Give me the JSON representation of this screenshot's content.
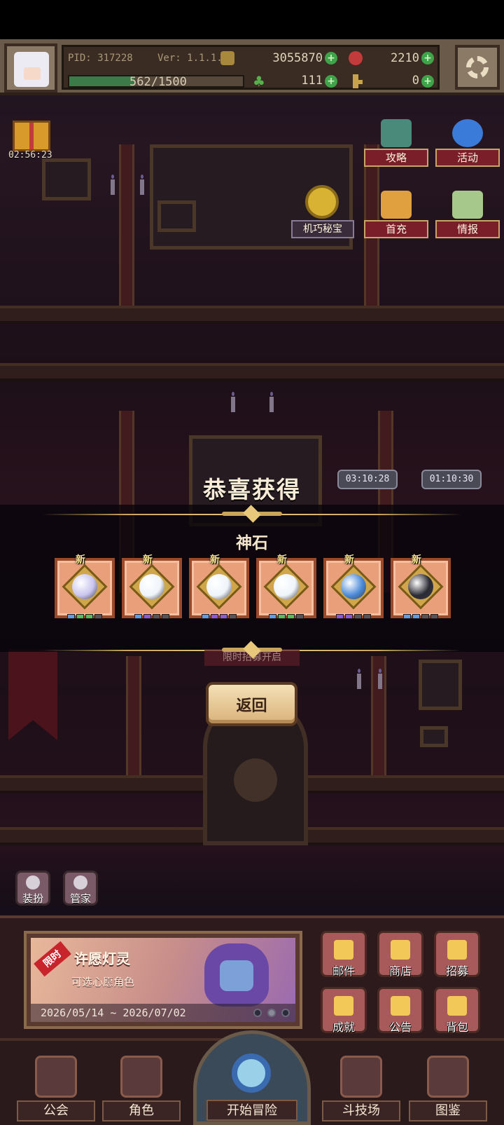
{
  "hud": {
    "pid_label": "PID: 317228",
    "version_label": "Ver: 1.1.1.4",
    "gold": "3055870",
    "gems": "2210",
    "exp_text": "562/1500",
    "exp_progress": 0.3747,
    "clover": "111",
    "keys": "0"
  },
  "gift_timer": "02:56:23",
  "top_menu": {
    "guide": "攻略",
    "events": "活动",
    "mech_treasure": "机巧秘宝",
    "first_recharge": "首充",
    "intel": "情报"
  },
  "timers": [
    "03:10:28",
    "01:10:30"
  ],
  "reward": {
    "title": "恭喜获得",
    "category": "神石",
    "new_badge": "新",
    "items": [
      {
        "gem_color": "#c8c4ee",
        "dots": [
          "#5aa0e8",
          "#52c05a",
          "#52c05a",
          "#55555a"
        ]
      },
      {
        "gem_color": "#eef4fa",
        "dots": [
          "#5aa0e8",
          "#8a5ad8",
          "#55555a",
          "#55555a"
        ]
      },
      {
        "gem_color": "#eef4fa",
        "dots": [
          "#5aa0e8",
          "#8a5ad8",
          "#8a5ad8",
          "#55555a"
        ]
      },
      {
        "gem_color": "#eef4fa",
        "dots": [
          "#5aa0e8",
          "#52c05a",
          "#52c05a",
          "#55555a"
        ]
      },
      {
        "gem_color": "#4a8ad8",
        "dots": [
          "#8a5ad8",
          "#8a5ad8",
          "#55555a",
          "#55555a"
        ]
      },
      {
        "gem_color": "#2a2a34",
        "dots": [
          "#5aa0e8",
          "#5aa0e8",
          "#55555a",
          "#55555a"
        ]
      }
    ],
    "return_label": "返回",
    "faded_label": "限时招募开启"
  },
  "mini": {
    "dress": "装扮",
    "butler": "管家"
  },
  "event": {
    "ribbon": "限时",
    "title": "许愿灯灵",
    "subtitle": "可选心愿角色",
    "date_range": "2026/05/14 ~ 2026/07/02"
  },
  "grid": {
    "mail": "邮件",
    "shop": "商店",
    "recruit": "招募",
    "achievements": "成就",
    "notice": "公告",
    "bag": "背包"
  },
  "nav": {
    "guild": "公会",
    "characters": "角色",
    "adventure": "开始冒险",
    "arena": "斗技场",
    "codex": "图鉴"
  }
}
